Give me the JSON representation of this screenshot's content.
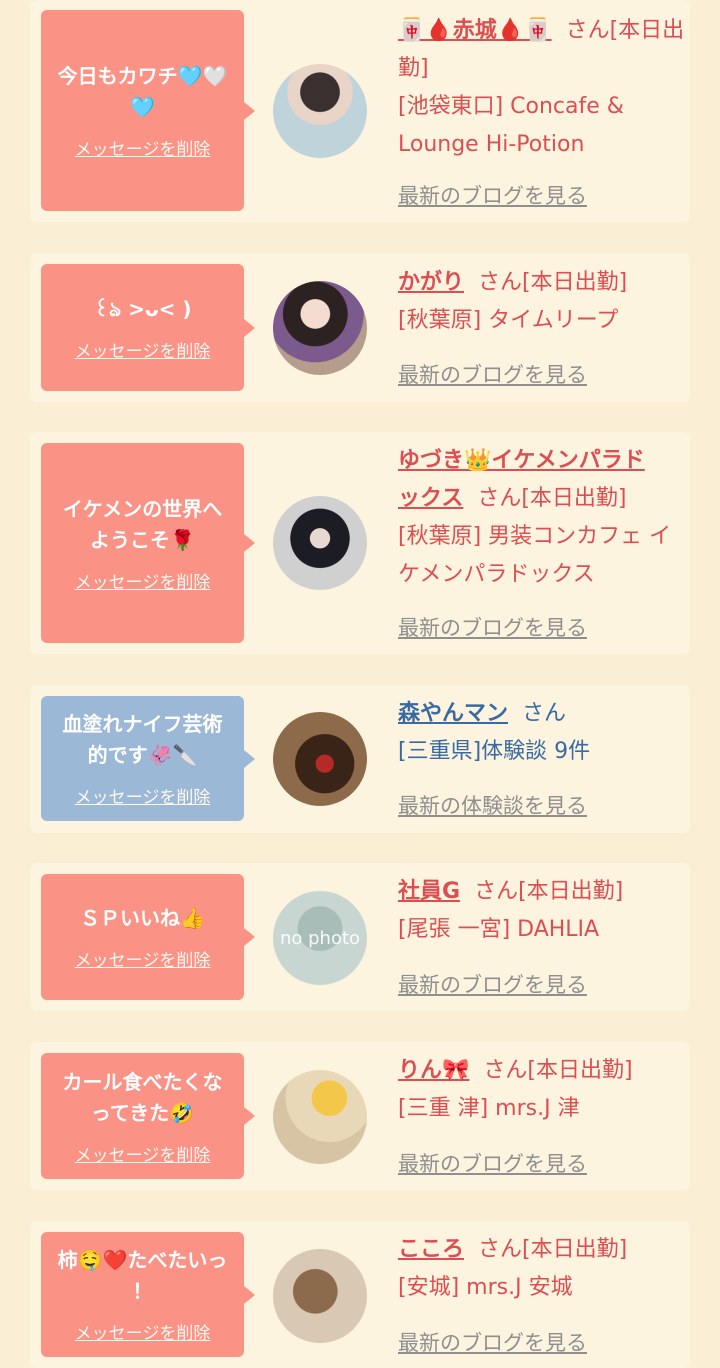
{
  "cards": [
    {
      "message": "今日もカワチ🩵🤍🩵",
      "delete_label": "メッセージを削除",
      "name": "🀄🩸赤城🩸🀄",
      "san": "さん[本日出勤]",
      "shop_line1": "[池袋東口] Concafe &",
      "shop_line2": "Lounge Hi-Potion",
      "link": "最新のブログを見る"
    },
    {
      "message": "꒰ঌ >ᴗ< )",
      "delete_label": "メッセージを削除",
      "name": "かがり",
      "san": "さん[本日出勤]",
      "shop_line1": "[秋葉原] タイムリープ",
      "link": "最新のブログを見る"
    },
    {
      "message_line1": "イケメンの世界へ",
      "message_line2": "ようこそ🌹",
      "delete_label": "メッセージを削除",
      "name_line1": "ゆづき👑イケメンパラド",
      "name_line2": "ックス",
      "san": "さん[本日出勤]",
      "shop_line1": "[秋葉原] 男装コンカフェ イ",
      "shop_line2": "ケメンパラドックス",
      "link": "最新のブログを見る"
    },
    {
      "message_line1": "血塗れナイフ芸術",
      "message_line2": "的です🦑🔪",
      "delete_label": "メッセージを削除",
      "name": "森やんマン",
      "san": "さん",
      "shop_line1": "[三重県]体験談 9件",
      "link": "最新の体験談を見る"
    },
    {
      "message": "ＳＰいいね👍",
      "delete_label": "メッセージを削除",
      "name": "社員G",
      "san": "さん[本日出勤]",
      "shop_line1": "[尾張 一宮] DAHLIA",
      "link": "最新のブログを見る",
      "avatar_text": "no photo"
    },
    {
      "message_line1": "カール食べたくな",
      "message_line2": "ってきた🤣",
      "delete_label": "メッセージを削除",
      "name": "りん🎀",
      "san": "さん[本日出勤]",
      "shop_line1": "[三重 津] mrs.J 津",
      "link": "最新のブログを見る"
    },
    {
      "message_line1": "柿🤤❤️たべたいっ",
      "message_line2": "！",
      "delete_label": "メッセージを削除",
      "name": "こころ",
      "san": "さん[本日出勤]",
      "shop_line1": "[安城] mrs.J 安城",
      "link": "最新のブログを見る"
    }
  ],
  "colors": {
    "page_bg": "#faefd5",
    "card_bg": "#fdf4e0",
    "bubble_pink": "#fb9286",
    "bubble_blue": "#9bb8d6",
    "cast_red": "#dc4e52",
    "user_blue": "#3a6aa3",
    "link_gray": "#8f8f8f"
  },
  "icons": {
    "avatar_0": "profile-photo",
    "avatar_4": "no-photo-placeholder"
  }
}
